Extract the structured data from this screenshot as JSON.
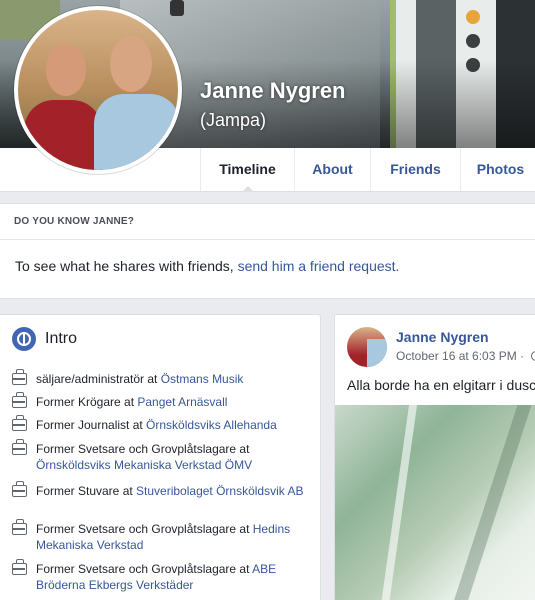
{
  "profile": {
    "name": "Janne Nygren",
    "alternate_name": "(Jampa)"
  },
  "nav": {
    "tabs": [
      {
        "label": "Timeline"
      },
      {
        "label": "About"
      },
      {
        "label": "Friends"
      },
      {
        "label": "Photos"
      }
    ]
  },
  "know": {
    "heading": "DO YOU KNOW JANNE?",
    "text": "To see what he shares with friends, ",
    "link": "send him a friend request."
  },
  "intro": {
    "title": "Intro",
    "items": [
      {
        "prefix": "säljare/administratör at ",
        "link": "Östmans Musik"
      },
      {
        "prefix": "Former Krögare at ",
        "link": "Panget Arnäsvall"
      },
      {
        "prefix": "Former Journalist at ",
        "link": "Örnsköldsviks Allehanda"
      },
      {
        "prefix": "Former Svetsare och Grovplåtslagare at ",
        "link": "Örnsköldsviks Mekaniska Verkstad ÖMV"
      },
      {
        "prefix": "Former Stuvare at ",
        "link": "Stuveribolaget Örnsköldsvik AB"
      },
      {
        "prefix": "Former Svetsare och Grovplåtslagare at ",
        "link": "Hedins Mekaniska Verkstad"
      },
      {
        "prefix": "Former Svetsare och Grovplåtslagare at ",
        "link": "ABE Bröderna Ekbergs Verkstäder"
      }
    ]
  },
  "post": {
    "author": "Janne Nygren",
    "date": "October 16 at 6:03 PM · ",
    "text": "Alla borde ha en elgitarr i dusche"
  }
}
